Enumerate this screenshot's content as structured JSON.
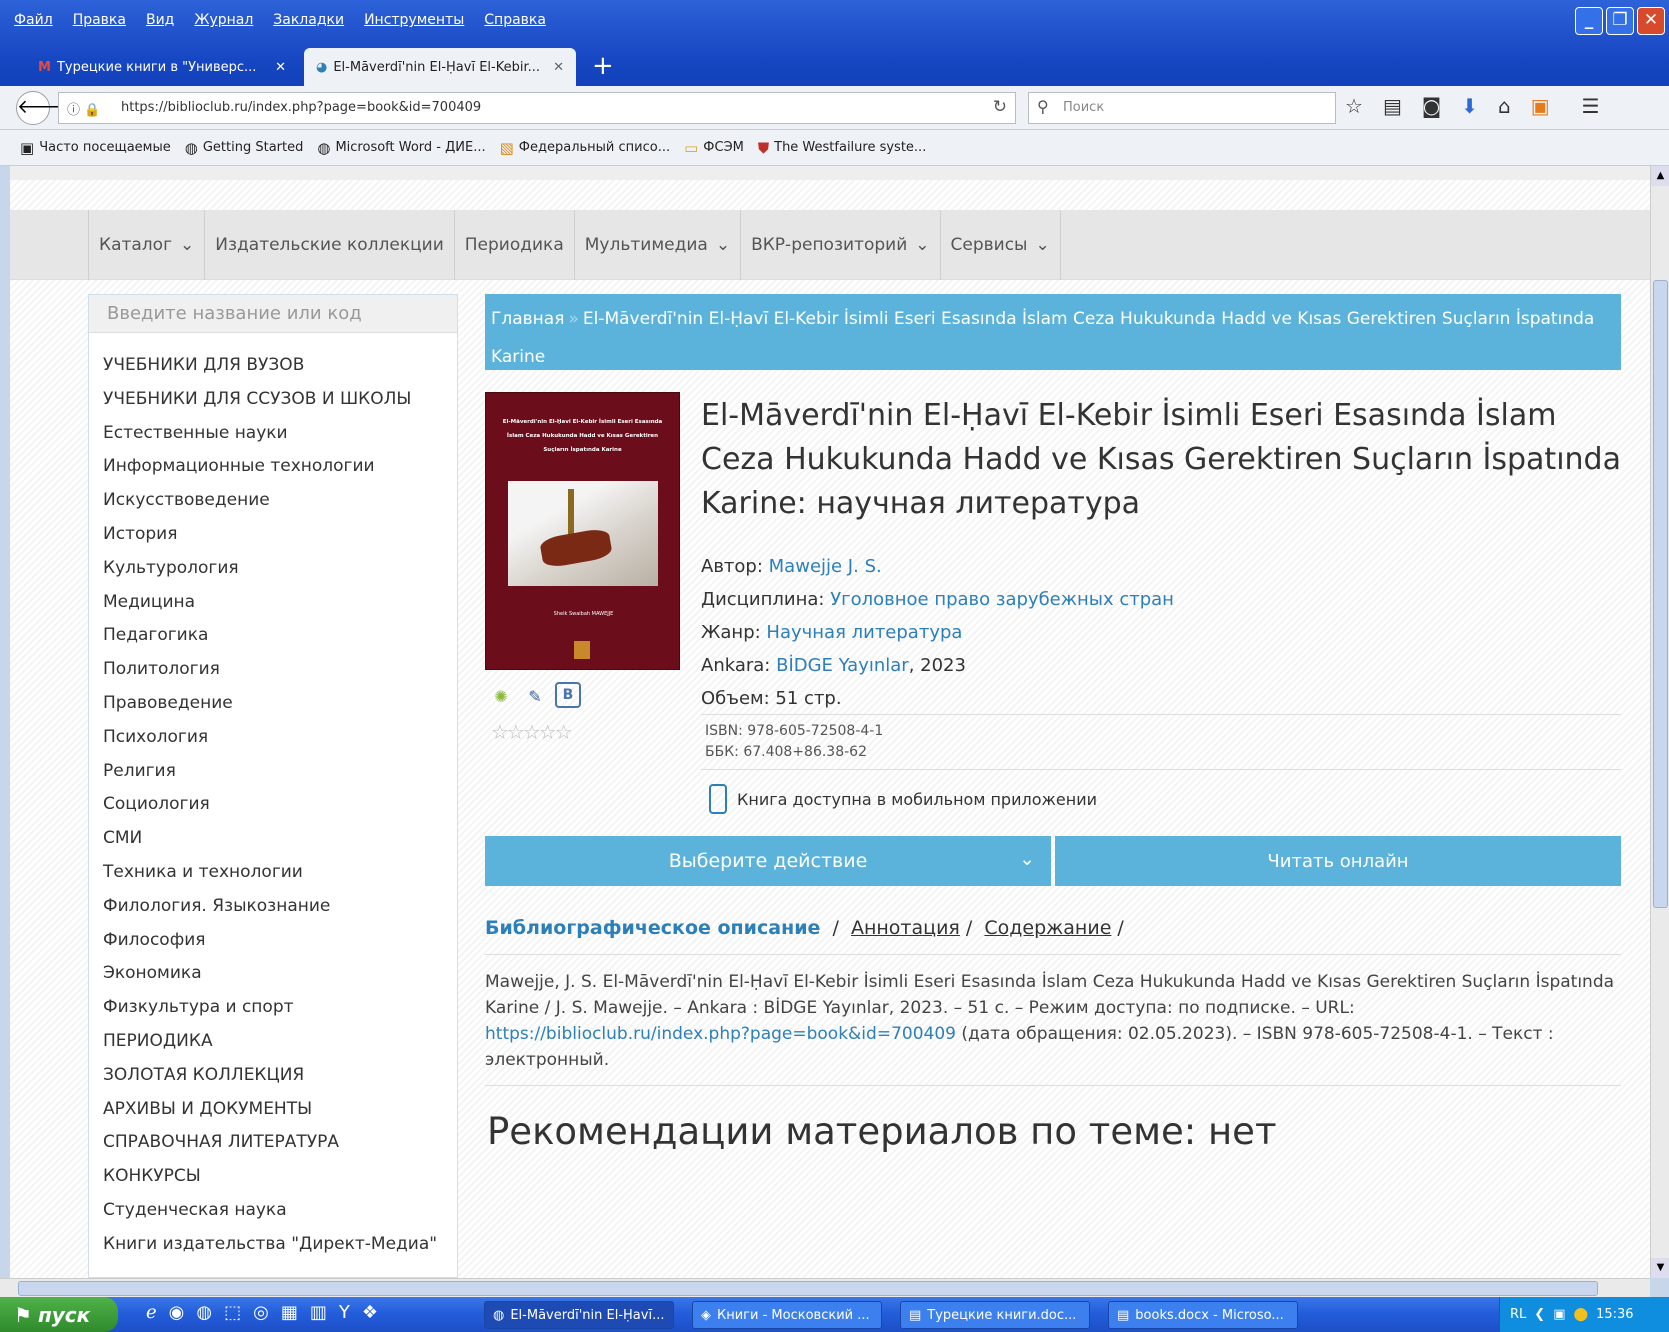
{
  "menu": [
    "Файл",
    "Правка",
    "Вид",
    "Журнал",
    "Закладки",
    "Инструменты",
    "Справка"
  ],
  "tabs": [
    {
      "title": "Турецкие книги в \"Универс...",
      "icon": "gmail-icon"
    },
    {
      "title": "El-Māverdī'nin El-Ḥavī El-Kebir...",
      "icon": "biblioclub-icon"
    }
  ],
  "address": {
    "url": "https://biblioclub.ru/index.php?page=book&id=700409",
    "search_placeholder": "Поиск"
  },
  "bookmarks": [
    "Часто посещаемые",
    "Getting Started",
    "Microsoft Word - ДИЕ...",
    "Федеральный списо...",
    "ФСЭМ",
    "The Westfailure syste..."
  ],
  "catnav": [
    "Каталог",
    "Издательские коллекции",
    "Периодика",
    "Мультимедиа",
    "ВКР-репозиторий",
    "Сервисы"
  ],
  "sidebar": {
    "search_placeholder": "Введите название или код",
    "items": [
      "УЧЕБНИКИ ДЛЯ ВУЗОВ",
      "УЧЕБНИКИ ДЛЯ ССУЗОВ И ШКОЛЫ",
      "Естественные науки",
      "Информационные технологии",
      "Искусствоведение",
      "История",
      "Культурология",
      "Медицина",
      "Педагогика",
      "Политология",
      "Правоведение",
      "Психология",
      "Религия",
      "Социология",
      "СМИ",
      "Техника и технологии",
      "Филология. Языкознание",
      "Философия",
      "Экономика",
      "Физкультура и спорт",
      "ПЕРИОДИКА",
      "ЗОЛОТАЯ КОЛЛЕКЦИЯ",
      "АРХИВЫ И ДОКУМЕНТЫ",
      "СПРАВОЧНАЯ ЛИТЕРАТУРА",
      "КОНКУРСЫ",
      "Студенческая наука",
      "Книги издательства \"Директ-Медиа\""
    ]
  },
  "breadcrumb": {
    "home": "Главная",
    "sep": "»",
    "current": "El-Māverdī'nin El-Ḥavī El-Kebir İsimli Eseri Esasında İslam Ceza Hukukunda Hadd ve Kısas Gerektiren Suçların İspatında Karine"
  },
  "book": {
    "title": "El-Māverdī'nin El-Ḥavī El-Kebir İsimli Eseri Esasında İslam Ceza Hukukunda Hadd ve Kısas Gerektiren Suçların İspatında Karine: научная литература",
    "author_label": "Автор:",
    "author": "Mawejje J. S.",
    "discipline_label": "Дисциплина:",
    "discipline": "Уголовное право зарубежных стран",
    "genre_label": "Жанр:",
    "genre": "Научная литература",
    "city": "Ankara:",
    "publisher": "BİDGE Yayınlar",
    "year": ", 2023",
    "volume": "Объем: 51 стр.",
    "isbn": "ISBN: 978-605-72508-4-1",
    "bbk": "ББК: 67.408+86.38-62",
    "mobile": "Книга доступна в мобильном приложении",
    "rating_stars": 0
  },
  "actions": {
    "choose": "Выберите действие",
    "read": "Читать онлайн"
  },
  "desc_tabs": {
    "bib": "Библиографическое описание",
    "annot": "Аннотация",
    "contents": "Содержание"
  },
  "description": {
    "before": "Mawejje, J. S. El-Māverdī'nin El-Ḥavī El-Kebir İsimli Eseri Esasında İslam Ceza Hukukunda Hadd ve Kısas Gerektiren Suçların İspatında Karine / J. S. Mawejje. – Ankara : BİDGE Yayınlar, 2023. – 51 с. – Режим доступа: по подписке. – URL: ",
    "link": "https://biblioclub.ru/index.php?page=book&id=700409",
    "after": " (дата обращения: 02.05.2023). – ISBN 978-605-72508-4-1. – Текст : электронный."
  },
  "recommendations": "Рекомендации материалов по теме: нет",
  "taskbar": {
    "start": "пуск",
    "tasks": [
      "El-Māverdī'nin El-Ḥavī...",
      "Книги - Московский ...",
      "Турецкие книги.doc...",
      "books.docx - Microso..."
    ],
    "lang": "RL",
    "clock": "15:36"
  }
}
